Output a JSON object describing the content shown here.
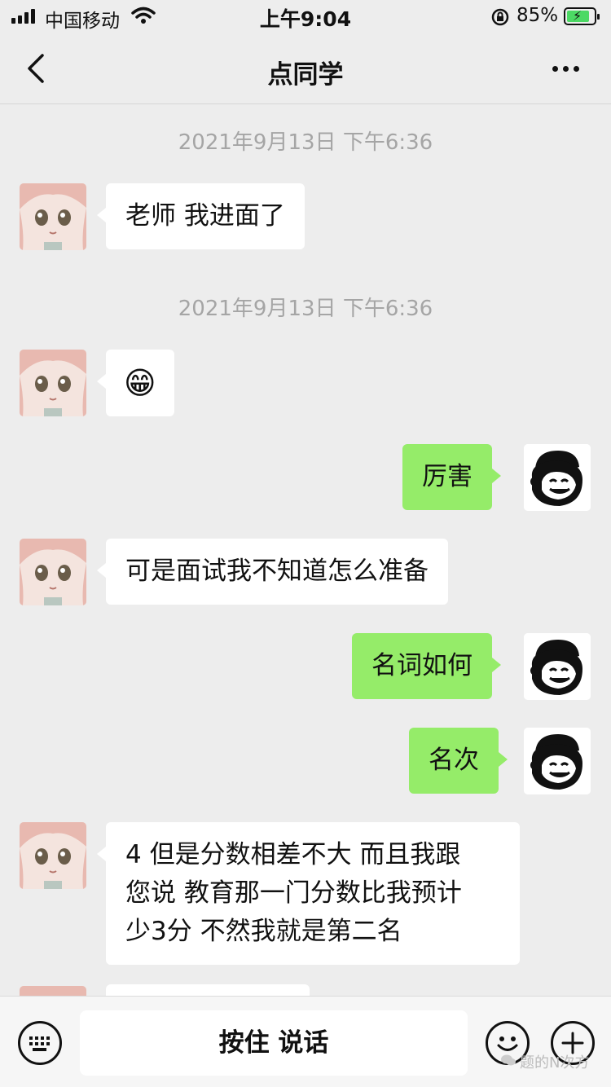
{
  "status_bar": {
    "carrier": "中国移动",
    "time": "上午9:04",
    "battery_percent": "85%",
    "battery_level": 0.85,
    "icons": [
      "signal-icon",
      "wifi-icon",
      "orientation-lock-icon",
      "battery-charging-icon"
    ]
  },
  "nav": {
    "title": "点同学",
    "icons": [
      "back-chevron-icon",
      "more-icon"
    ]
  },
  "messages": {
    "ts1": "2021年9月13日 下午6:36",
    "msg1": "老师 我进面了",
    "ts2": "2021年9月13日 下午6:36",
    "msg2_emoji": "😁",
    "msg3": "厉害",
    "msg4": "可是面试我不知道怎么准备",
    "msg5": "名词如何",
    "msg6": "名次",
    "msg7_line1": "4 但是分数相差不大 而且我跟",
    "msg7_line2": "您说 教育那一门分数比我预计",
    "msg7_line3": "少3分 不然我就是第二名"
  },
  "input_bar": {
    "hold_to_talk": "按住 说话",
    "icons": [
      "keyboard-icon",
      "emoji-icon",
      "add-icon"
    ]
  },
  "watermark": "题的N次方",
  "colors": {
    "background": "#ededed",
    "outgoing_bubble": "#95ec69",
    "incoming_bubble": "#ffffff",
    "timestamp_text": "#a5a5a5"
  }
}
